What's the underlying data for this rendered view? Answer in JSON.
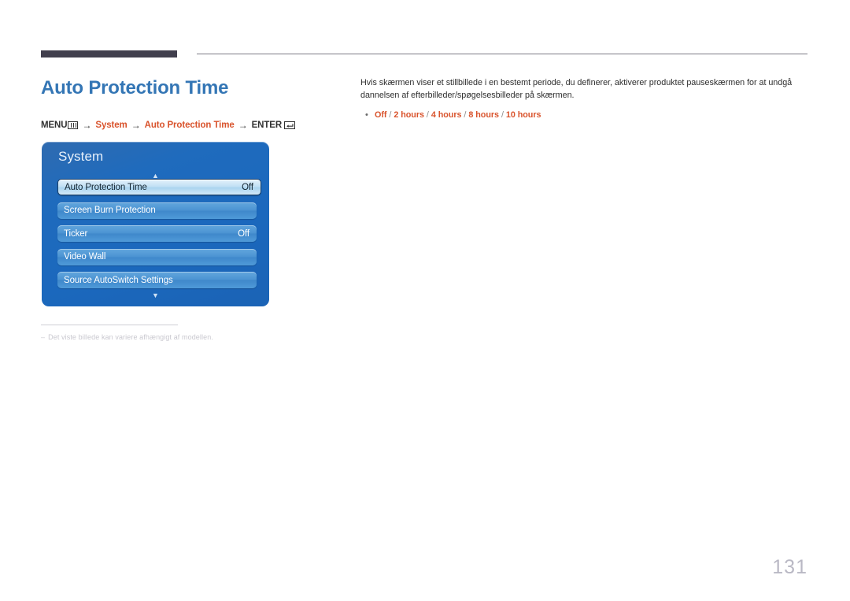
{
  "page": {
    "title": "Auto Protection Time",
    "number": "131"
  },
  "breadcrumb": {
    "menu_label": "MENU",
    "menu_icon": "menu-grid-icon",
    "arrow": "→",
    "step_system": "System",
    "step_feature": "Auto Protection Time",
    "enter_label": "ENTER",
    "enter_icon": "enter-return-icon"
  },
  "osd": {
    "title": "System",
    "scroll_up_icon": "chevron-up-icon",
    "scroll_down_icon": "chevron-down-icon",
    "items": [
      {
        "label": "Auto Protection Time",
        "value": "Off",
        "selected": true
      },
      {
        "label": "Screen Burn Protection",
        "value": "",
        "selected": false
      },
      {
        "label": "Ticker",
        "value": "Off",
        "selected": false
      },
      {
        "label": "Video Wall",
        "value": "",
        "selected": false
      },
      {
        "label": "Source AutoSwitch Settings",
        "value": "",
        "selected": false
      }
    ]
  },
  "footnote": {
    "dash": "–",
    "text": "Det viste billede kan variere afhængigt af modellen."
  },
  "body": {
    "paragraph": "Hvis skærmen viser et stillbillede i en bestemt periode, du definerer, aktiverer produktet pauseskærmen for at undgå dannelsen af efterbilleder/spøgelsesbilleder på skærmen.",
    "bullet_dot": "•",
    "options": [
      "Off",
      "2 hours",
      "4 hours",
      "8 hours",
      "10 hours"
    ],
    "option_separator": "/"
  },
  "colors": {
    "title_blue": "#3476b5",
    "accent_orange": "#d9532c",
    "rule_dark": "#413f4d",
    "osd_blue": "#1f6bbd",
    "page_number_gray": "#b9b8c4"
  }
}
